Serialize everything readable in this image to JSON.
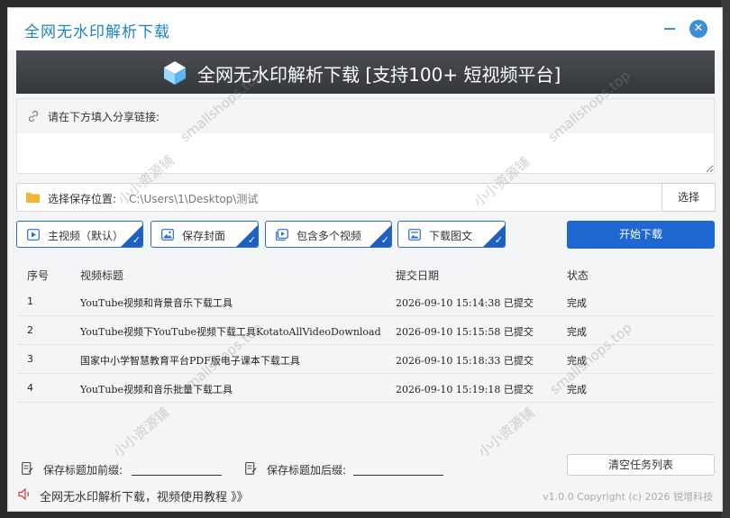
{
  "window": {
    "app_title": "全网无水印解析下载",
    "minimize_label": "—",
    "close_label": "✕"
  },
  "banner": {
    "title": "全网无水印解析下载 [支持100+ 短视频平台]"
  },
  "link_section": {
    "label": "请在下方填入分享链接:",
    "value": ""
  },
  "save_location": {
    "label": "选择保存位置:",
    "path": "C:\\Users\\1\\Desktop\\测试",
    "choose_button": "选择"
  },
  "options": [
    {
      "label": "主视频（默认）",
      "icon": "video-icon",
      "checked": true
    },
    {
      "label": "保存封面",
      "icon": "image-icon",
      "checked": true
    },
    {
      "label": "包含多个视频",
      "icon": "multi-video-icon",
      "checked": true
    },
    {
      "label": "下载图文",
      "icon": "gallery-icon",
      "checked": true
    }
  ],
  "start_button": "开始下载",
  "table": {
    "columns": [
      "序号",
      "视频标题",
      "提交日期",
      "状态"
    ],
    "rows": [
      {
        "no": "1",
        "title": "YouTube视频和背景音乐下载工具",
        "date": "2026-09-10  15:14:38 已提交",
        "status": "完成"
      },
      {
        "no": "2",
        "title": "YouTube视频下YouTube视频下载工具KotatoAllVideoDownload",
        "date": "2026-09-10  15:15:58 已提交",
        "status": "完成"
      },
      {
        "no": "3",
        "title": "国家中小学智慧教育平台PDF版电子课本下载工具",
        "date": "2026-09-10  15:18:33 已提交",
        "status": "完成"
      },
      {
        "no": "4",
        "title": "YouTube视频和音乐批量下载工具",
        "date": "2026-09-10  15:19:18 已提交",
        "status": "完成"
      }
    ]
  },
  "bottom": {
    "prefix_label": "保存标题加前缀:",
    "prefix_value": "",
    "suffix_label": "保存标题加后缀:",
    "suffix_value": "",
    "clear_button": "清空任务列表"
  },
  "footer": {
    "link_text": "全网无水印解析下载，视频使用教程 》》",
    "copyright": "v1.0.0 Copyright (c) 2026 锐增科技"
  },
  "watermarks": [
    "smallshops.top",
    "小小资源铺"
  ],
  "colors": {
    "accent": "#1f67d2",
    "title_blue": "#1c84c6",
    "banner_bg": "#3f4246"
  }
}
